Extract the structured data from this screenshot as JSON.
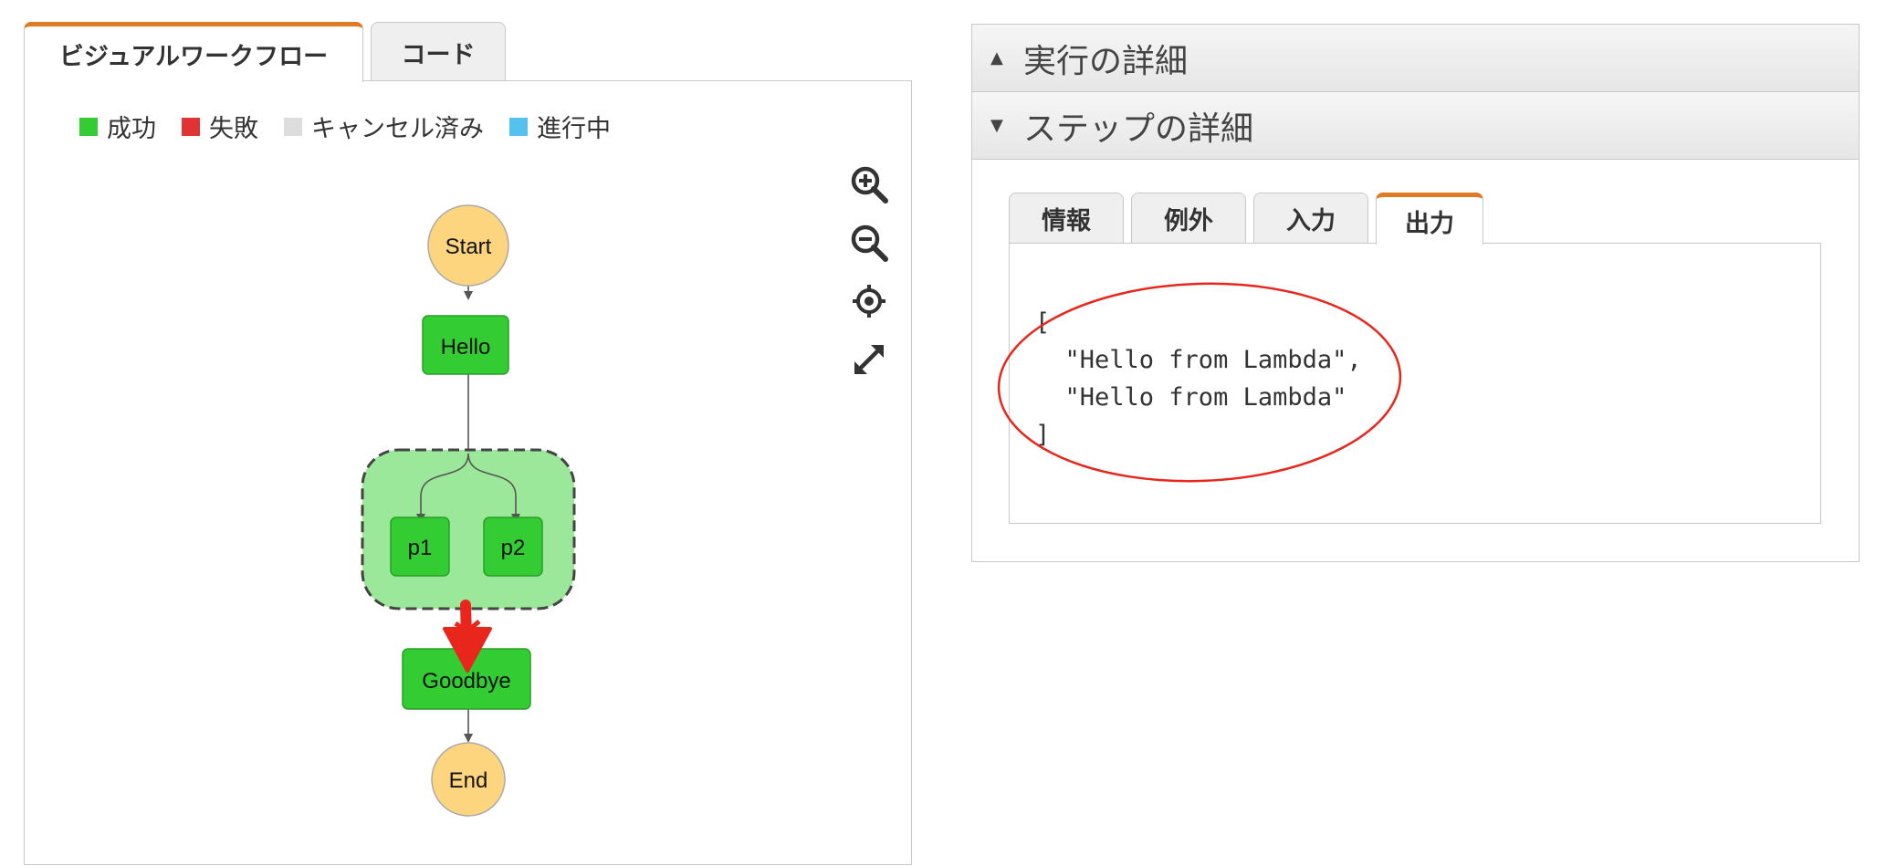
{
  "left_tabs": {
    "visual": "ビジュアルワークフロー",
    "code": "コード"
  },
  "legend": [
    {
      "label": "成功",
      "color": "#33cc33"
    },
    {
      "label": "失敗",
      "color": "#e03333"
    },
    {
      "label": "キャンセル済み",
      "color": "#dddddd"
    },
    {
      "label": "進行中",
      "color": "#55c2ee"
    }
  ],
  "workflow": {
    "nodes": {
      "start": "Start",
      "hello": "Hello",
      "p1": "p1",
      "p2": "p2",
      "goodbye": "Goodbye",
      "end": "End"
    },
    "colors": {
      "terminal": "#fdd57e",
      "success": "#33cc33",
      "parallel_bg": "#9ce89a",
      "edge": "#555555",
      "annotation": "#e8261c"
    }
  },
  "tool_icons": [
    "zoom-in-icon",
    "zoom-out-icon",
    "center-icon",
    "expand-icon"
  ],
  "details": {
    "execution_header": "実行の詳細",
    "step_header": "ステップの詳細",
    "tabs": [
      "情報",
      "例外",
      "入力",
      "出力"
    ],
    "active_tab": "出力",
    "output": "[\n  \"Hello from Lambda\",\n  \"Hello from Lambda\"\n]"
  },
  "accent_color": "#e07b24"
}
